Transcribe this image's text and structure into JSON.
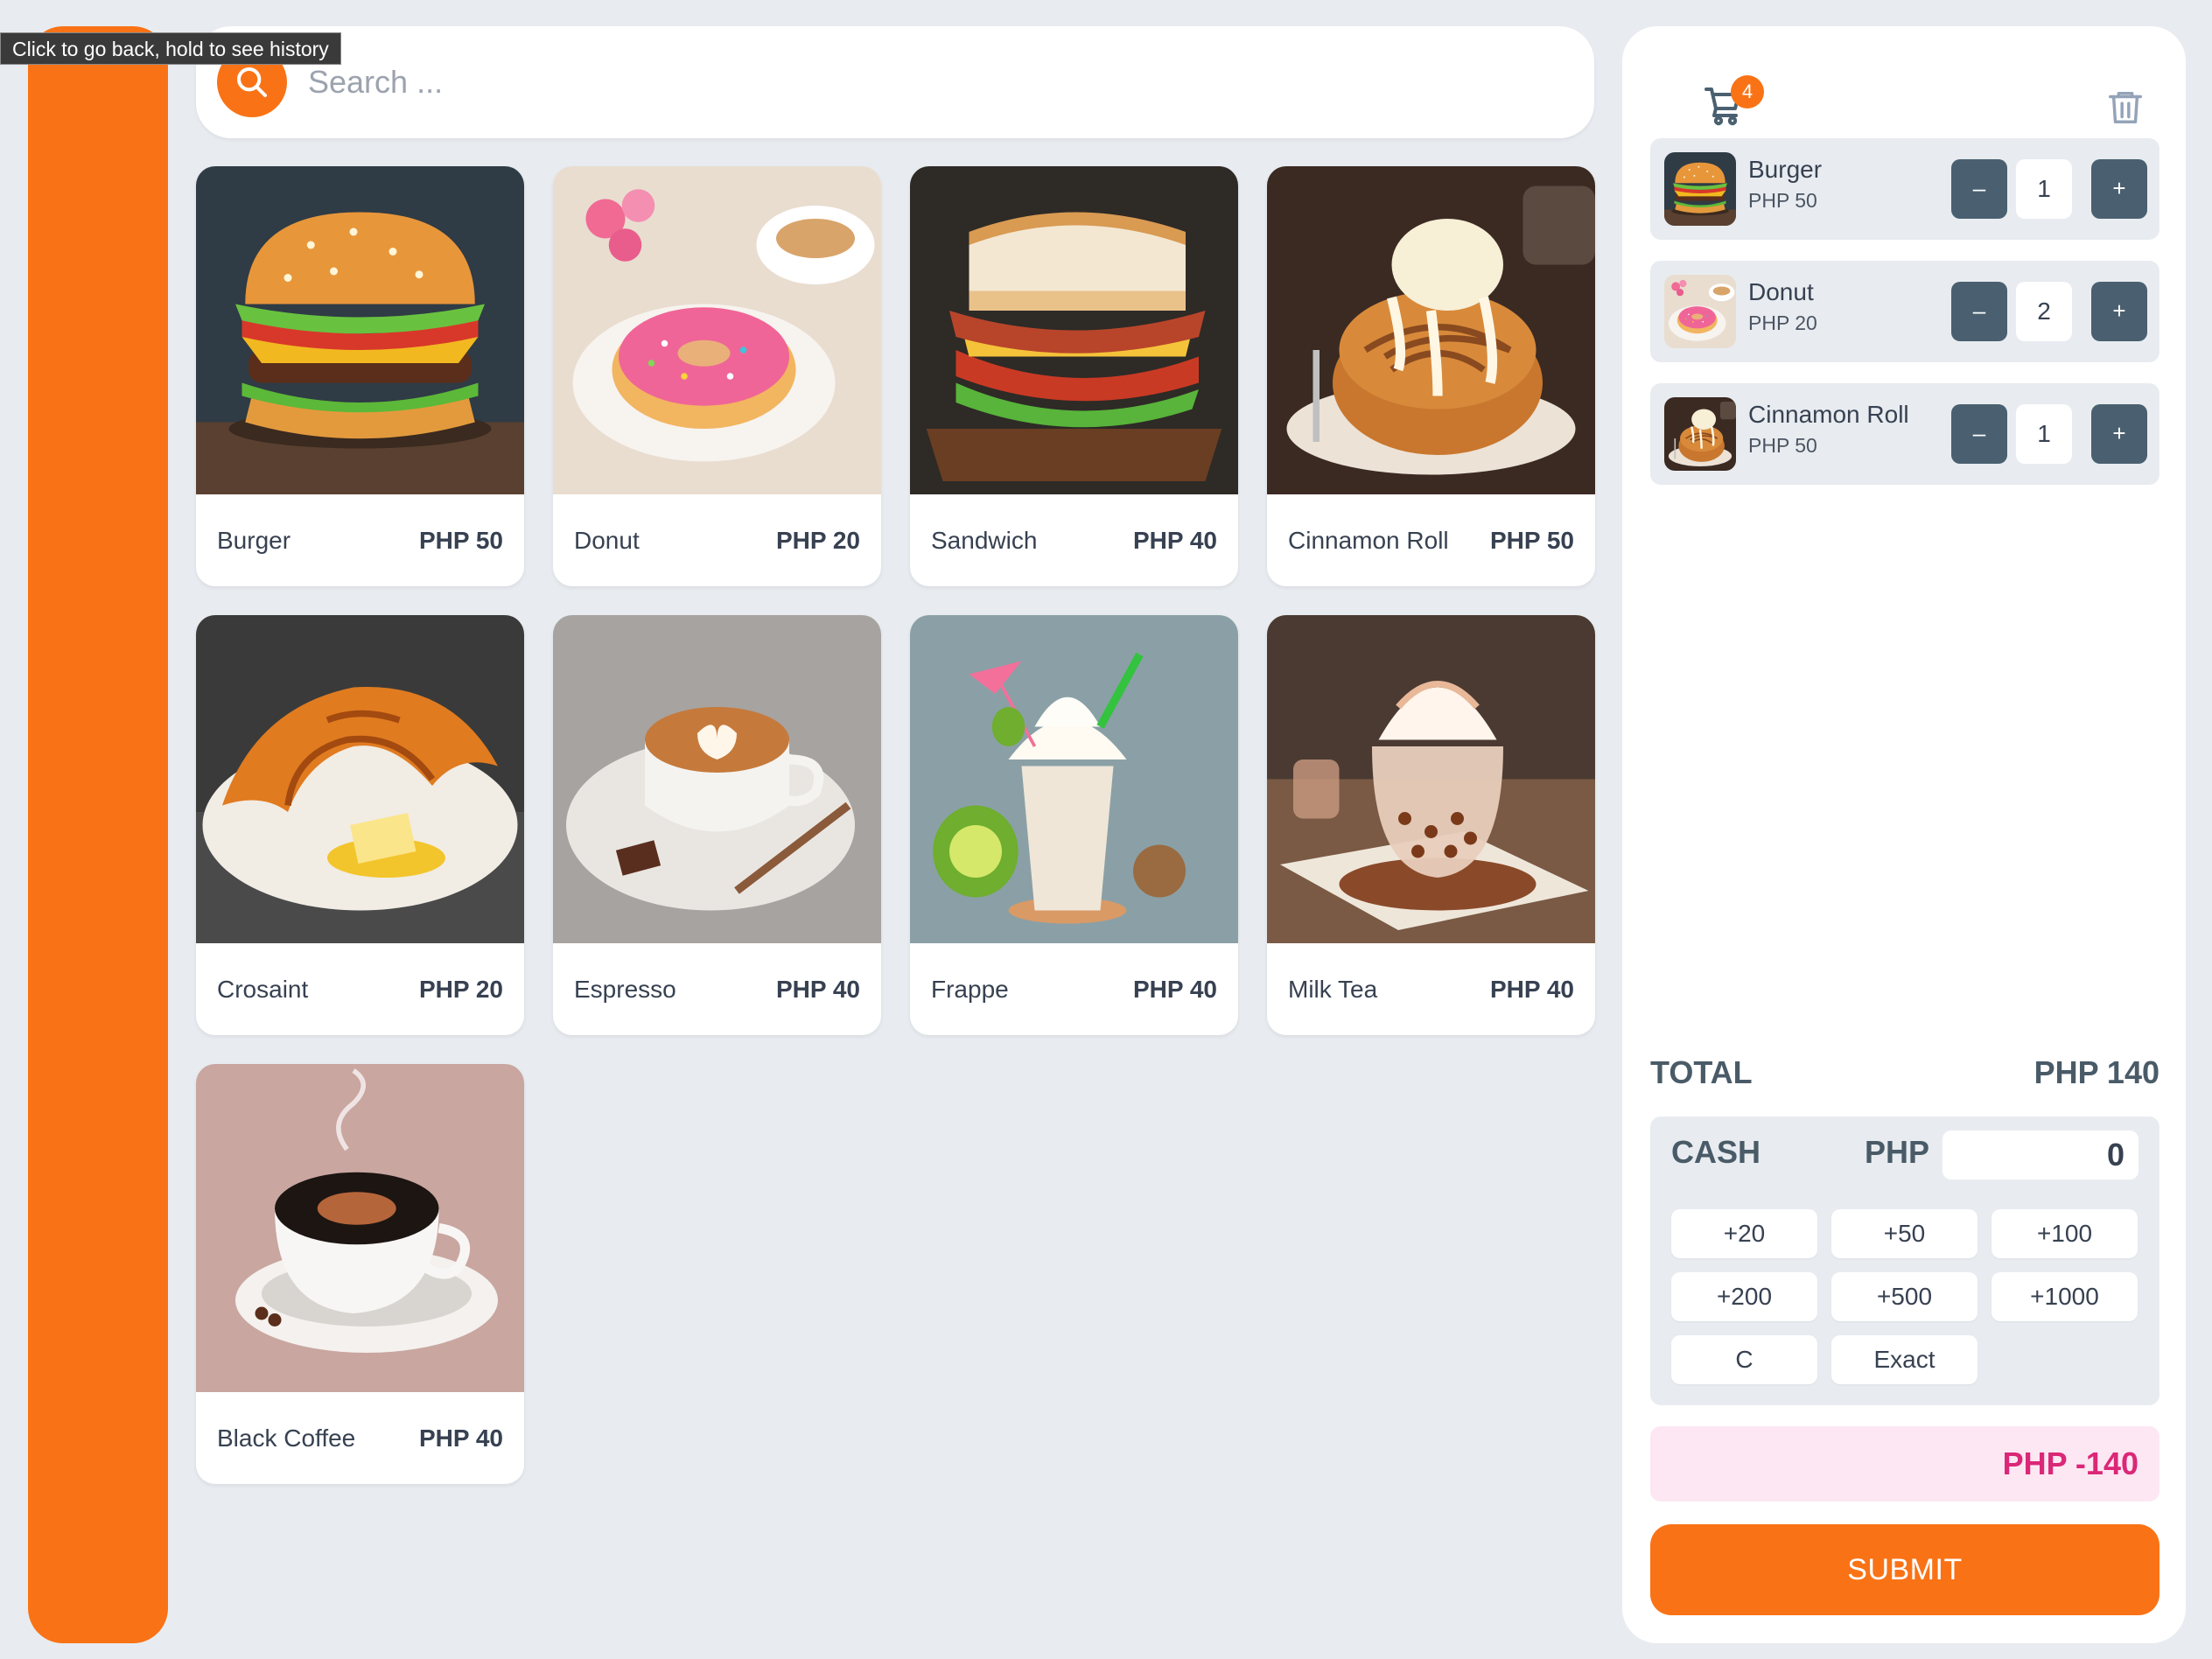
{
  "browser": {
    "tooltip": "Click to go back, hold to see history"
  },
  "search": {
    "placeholder": "Search ..."
  },
  "products": [
    {
      "name": "Burger",
      "price": "PHP 50"
    },
    {
      "name": "Donut",
      "price": "PHP 20"
    },
    {
      "name": "Sandwich",
      "price": "PHP 40"
    },
    {
      "name": "Cinnamon Roll",
      "price": "PHP 50"
    },
    {
      "name": "Crosaint",
      "price": "PHP 20"
    },
    {
      "name": "Espresso",
      "price": "PHP 40"
    },
    {
      "name": "Frappe",
      "price": "PHP 40"
    },
    {
      "name": "Milk Tea",
      "price": "PHP 40"
    },
    {
      "name": "Black Coffee",
      "price": "PHP 40"
    }
  ],
  "cart": {
    "badge_count": "4",
    "items": [
      {
        "name": "Burger",
        "price": "PHP 50",
        "qty": "1",
        "minus": "–",
        "plus": "+"
      },
      {
        "name": "Donut",
        "price": "PHP 20",
        "qty": "2",
        "minus": "–",
        "plus": "+"
      },
      {
        "name": "Cinnamon Roll",
        "price": "PHP 50",
        "qty": "1",
        "minus": "–",
        "plus": "+"
      }
    ],
    "total_label": "TOTAL",
    "total_value": "PHP 140",
    "cash_label": "CASH",
    "cash_currency": "PHP",
    "cash_value": "0",
    "quick_cash": [
      "+20",
      "+50",
      "+100",
      "+200",
      "+500",
      "+1000",
      "C",
      "Exact"
    ],
    "change": "PHP -140",
    "submit_label": "SUBMIT"
  },
  "colors": {
    "accent": "#f97316",
    "background": "#e8ecf0",
    "qty_button": "#4a6070",
    "change_text": "#db2777",
    "change_bg": "#fce7f3"
  },
  "icons": {
    "search": "search-icon",
    "cart": "cart-icon",
    "trash": "trash-icon"
  }
}
